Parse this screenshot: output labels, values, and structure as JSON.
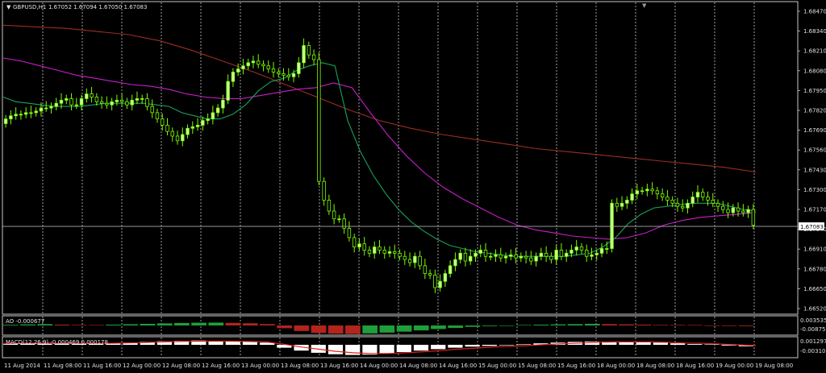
{
  "header": {
    "symbol_label": "GBPUSD,H1",
    "ohlc_label": "1.67052 1.67094 1.67050 1.67083"
  },
  "ao_panel": {
    "label": "AO -0.000677",
    "ticks": [
      "0.003535",
      "-0.008759"
    ]
  },
  "macd_panel": {
    "label": "MACD(12,26,9) -0.000469 0.000178",
    "ticks": [
      "0.001297",
      "-0.003102"
    ]
  },
  "colors": {
    "background": "#000000",
    "frame": "#c8c8c8",
    "grid": "#c8c8c8",
    "bull_candle": "#c8ff9b",
    "bear_candle": "#000000",
    "candle_wick": "#7cfc00",
    "ma_fast": "#19a35a",
    "ma_mid": "#c71fc7",
    "ma_slow": "#9b2f24",
    "ao_up": "#1f9e3a",
    "ao_down": "#b3241c",
    "macd_hist": "#ffffff",
    "macd_signal": "#e0201a",
    "price_line": "#c8c8c8"
  },
  "chart_data": {
    "type": "candlestick",
    "title": "GBPUSD,H1",
    "current_price": "1.67083",
    "ylim": [
      1.6652,
      1.6847
    ],
    "y_ticks": [
      "1.68470",
      "1.68340",
      "1.68210",
      "1.68080",
      "1.67950",
      "1.67820",
      "1.67690",
      "1.67560",
      "1.67430",
      "1.67300",
      "1.67170",
      "1.67040",
      "1.66910",
      "1.66780",
      "1.66650",
      "1.66520"
    ],
    "x_ticks": [
      "11 Aug 2014",
      "11 Aug 08:00",
      "11 Aug 16:00",
      "12 Aug 00:00",
      "12 Aug 08:00",
      "12 Aug 16:00",
      "13 Aug 00:00",
      "13 Aug 08:00",
      "13 Aug 16:00",
      "14 Aug 00:00",
      "14 Aug 08:00",
      "14 Aug 16:00",
      "15 Aug 00:00",
      "15 Aug 08:00",
      "15 Aug 16:00",
      "18 Aug 00:00",
      "18 Aug 08:00",
      "18 Aug 16:00",
      "19 Aug 00:00",
      "19 Aug 08:00"
    ],
    "grid": "vertical dashed at each time label",
    "candles_close": [
      1.6776,
      1.6778,
      1.6779,
      1.6779,
      1.678,
      1.678,
      1.6781,
      1.6783,
      1.6783,
      1.6784,
      1.6786,
      1.6788,
      1.6789,
      1.6785,
      1.6785,
      1.6789,
      1.6792,
      1.679,
      1.6787,
      1.6786,
      1.6785,
      1.6787,
      1.6788,
      1.6787,
      1.6785,
      1.6788,
      1.6789,
      1.6789,
      1.6784,
      1.678,
      1.6776,
      1.6772,
      1.6768,
      1.6765,
      1.6762,
      1.6766,
      1.677,
      1.6771,
      1.6772,
      1.6775,
      1.6776,
      1.678,
      1.6783,
      1.6788,
      1.68,
      1.6806,
      1.6808,
      1.681,
      1.6812,
      1.6813,
      1.6811,
      1.681,
      1.6808,
      1.6806,
      1.6805,
      1.6804,
      1.6803,
      1.6805,
      1.6812,
      1.6823,
      1.6817,
      1.6814,
      1.6736,
      1.6724,
      1.6717,
      1.6712,
      1.6712,
      1.6706,
      1.67,
      1.6694,
      1.6696,
      1.6692,
      1.669,
      1.6694,
      1.6692,
      1.669,
      1.6691,
      1.669,
      1.6688,
      1.6686,
      1.6684,
      1.6688,
      1.6682,
      1.6677,
      1.6676,
      1.6668,
      1.6672,
      1.6677,
      1.6682,
      1.6686,
      1.669,
      1.6685,
      1.6688,
      1.669,
      1.6692,
      1.6688,
      1.6688,
      1.6689,
      1.6687,
      1.6688,
      1.6689,
      1.6687,
      1.6688,
      1.6687,
      1.6685,
      1.6688,
      1.669,
      1.6688,
      1.6686,
      1.6692,
      1.6688,
      1.669,
      1.6692,
      1.6694,
      1.6692,
      1.6688,
      1.6689,
      1.669,
      1.6693,
      1.6693,
      1.6722,
      1.672,
      1.6722,
      1.6724,
      1.6728,
      1.673,
      1.673,
      1.6731,
      1.673,
      1.6728,
      1.6726,
      1.6724,
      1.6722,
      1.672,
      1.6719,
      1.6722,
      1.6726,
      1.6729,
      1.6726,
      1.6724,
      1.6722,
      1.672,
      1.6718,
      1.6716,
      1.6719,
      1.6717,
      1.6716,
      1.6718,
      1.6708
    ],
    "ma_fast": [
      1.679,
      1.6787,
      1.6786,
      1.6785,
      1.6784,
      1.6784,
      1.6784,
      1.6785,
      1.6786,
      1.6786,
      1.6786,
      1.6786,
      1.6785,
      1.6784,
      1.678,
      1.6778,
      1.6776,
      1.6776,
      1.6779,
      1.6785,
      1.6794,
      1.68,
      1.6802,
      1.6807,
      1.681,
      1.6812,
      1.681,
      1.6775,
      1.6755,
      1.674,
      1.6728,
      1.6718,
      1.671,
      1.6704,
      1.6699,
      1.6695,
      1.6693,
      1.6691,
      1.669,
      1.6689,
      1.6688,
      1.6688,
      1.6688,
      1.6688,
      1.6688,
      1.6689,
      1.669,
      1.6694,
      1.67,
      1.6709,
      1.6715,
      1.6719,
      1.672,
      1.6721,
      1.6722,
      1.6722,
      1.6722,
      1.672,
      1.6718,
      1.6717
    ],
    "ma_mid": [
      1.6815,
      1.6813,
      1.681,
      1.6807,
      1.6804,
      1.6802,
      1.68,
      1.6798,
      1.6797,
      1.6795,
      1.6792,
      1.679,
      1.6789,
      1.6789,
      1.6791,
      1.6793,
      1.6795,
      1.6796,
      1.6799,
      1.6796,
      1.678,
      1.6765,
      1.6752,
      1.6741,
      1.6732,
      1.6725,
      1.6719,
      1.6713,
      1.6708,
      1.6705,
      1.6703,
      1.6701,
      1.67,
      1.6699,
      1.67,
      1.6703,
      1.6708,
      1.6711,
      1.6713,
      1.6714,
      1.6715,
      1.6716
    ],
    "ma_slow": [
      1.6836,
      1.6835,
      1.6834,
      1.6832,
      1.683,
      1.6826,
      1.682,
      1.6813,
      1.6806,
      1.6798,
      1.679,
      1.6782,
      1.6775,
      1.677,
      1.6766,
      1.6763,
      1.676,
      1.6757,
      1.6755,
      1.6753,
      1.6751,
      1.6749,
      1.6747,
      1.6745,
      1.6742
    ],
    "ao_values": [
      0.0005,
      0.0008,
      0.001,
      0.0006,
      0.0004,
      0.0003,
      0.0006,
      0.0009,
      0.0012,
      0.0015,
      0.0018,
      0.002,
      0.0021,
      0.0019,
      0.0016,
      0.001,
      -0.002,
      -0.004,
      -0.0055,
      -0.006,
      -0.0062,
      -0.0058,
      -0.0052,
      -0.0045,
      -0.0036,
      -0.0026,
      -0.0018,
      -0.001,
      -0.0005,
      -0.0002,
      0.0003,
      0.0006,
      0.0008,
      0.001,
      0.0012,
      0.001,
      0.0008,
      0.0006,
      0.0004,
      0.0002,
      0.0001,
      -0.0002,
      -0.0004,
      -0.0005
    ],
    "macd_hist": [
      0.0004,
      0.0005,
      0.0005,
      0.0004,
      0.0003,
      0.0003,
      0.0004,
      0.0006,
      0.0008,
      0.001,
      0.0011,
      0.0012,
      0.0011,
      0.001,
      0.0009,
      0.0006,
      -0.0008,
      -0.0016,
      -0.0022,
      -0.0026,
      -0.0028,
      -0.0027,
      -0.0024,
      -0.002,
      -0.0016,
      -0.0012,
      -0.0008,
      -0.0005,
      -0.0003,
      -0.0001,
      0.0001,
      0.0004,
      0.0006,
      0.0008,
      0.0009,
      0.0009,
      0.0008,
      0.0007,
      0.0006,
      0.0004,
      0.0002,
      0.0,
      -0.0002,
      -0.0004
    ],
    "macd_signal": [
      0.0003,
      0.0004,
      0.0004,
      0.0004,
      0.0004,
      0.0004,
      0.0004,
      0.0005,
      0.0006,
      0.0008,
      0.0009,
      0.001,
      0.001,
      0.001,
      0.0009,
      0.0008,
      0.0002,
      -0.0006,
      -0.0012,
      -0.0018,
      -0.0022,
      -0.0024,
      -0.0024,
      -0.0022,
      -0.0019,
      -0.0016,
      -0.0012,
      -0.0009,
      -0.0006,
      -0.0004,
      -0.0002,
      0.0001,
      0.0003,
      0.0005,
      0.0007,
      0.0008,
      0.0008,
      0.0008,
      0.0007,
      0.0005,
      0.0004,
      0.0002,
      0.0,
      -0.0002
    ]
  }
}
